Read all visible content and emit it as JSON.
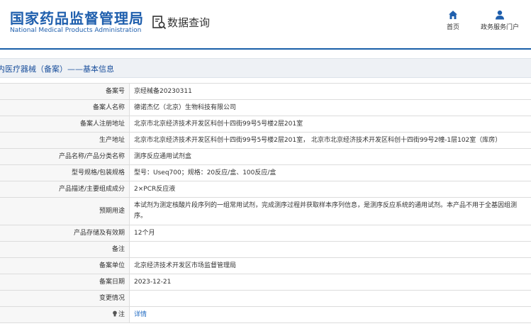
{
  "header": {
    "logo_cn": "国家药品监督管理局",
    "logo_en": "National Medical Products Administration",
    "query_title": "数据查询",
    "nav": [
      {
        "label": "首页",
        "icon": "home-icon"
      },
      {
        "label": "政务服务门户",
        "icon": "user-icon"
      }
    ]
  },
  "section": {
    "title": "内医疗器械（备案）——基本信息"
  },
  "colors": {
    "brand": "#1f5fad",
    "link": "#1f6ac2",
    "section_bg": "#eef1f5"
  },
  "records": [
    {
      "label": "备案号",
      "value": "京经械备20230311"
    },
    {
      "label": "备案人名称",
      "value": "德诺杰亿（北京）生物科技有限公司"
    },
    {
      "label": "备案人注册地址",
      "value": "北京市北京经济技术开发区科创十四街99号5号楼2层201室"
    },
    {
      "label": "生产地址",
      "value": "北京市北京经济技术开发区科创十四街99号5号楼2层201室， 北京市北京经济技术开发区科创十四街99号2幢-1层102室（库房）"
    },
    {
      "label": "产品名称/产品分类名称",
      "value": "测序反应通用试剂盒"
    },
    {
      "label": "型号规格/包装规格",
      "value": "型号：Useq700；规格：20反应/盒、100反应/盒"
    },
    {
      "label": "产品描述/主要组成成分",
      "value": "2×PCR反应液"
    },
    {
      "label": "预期用途",
      "value": "本试剂为测定核酸片段序列的一组常用试剂，完成测序过程并获取样本序列信息，是测序反应系统的通用试剂。本产品不用于全基因组测序。"
    },
    {
      "label": "产品存储及有效期",
      "value": "12个月"
    },
    {
      "label": "备注",
      "value": ""
    },
    {
      "label": "备案单位",
      "value": "北京经济技术开发区市场监督管理局"
    },
    {
      "label": "备案日期",
      "value": "2023-12-21"
    },
    {
      "label": "变更情况",
      "value": ""
    },
    {
      "label": "注",
      "value": "详情"
    }
  ]
}
